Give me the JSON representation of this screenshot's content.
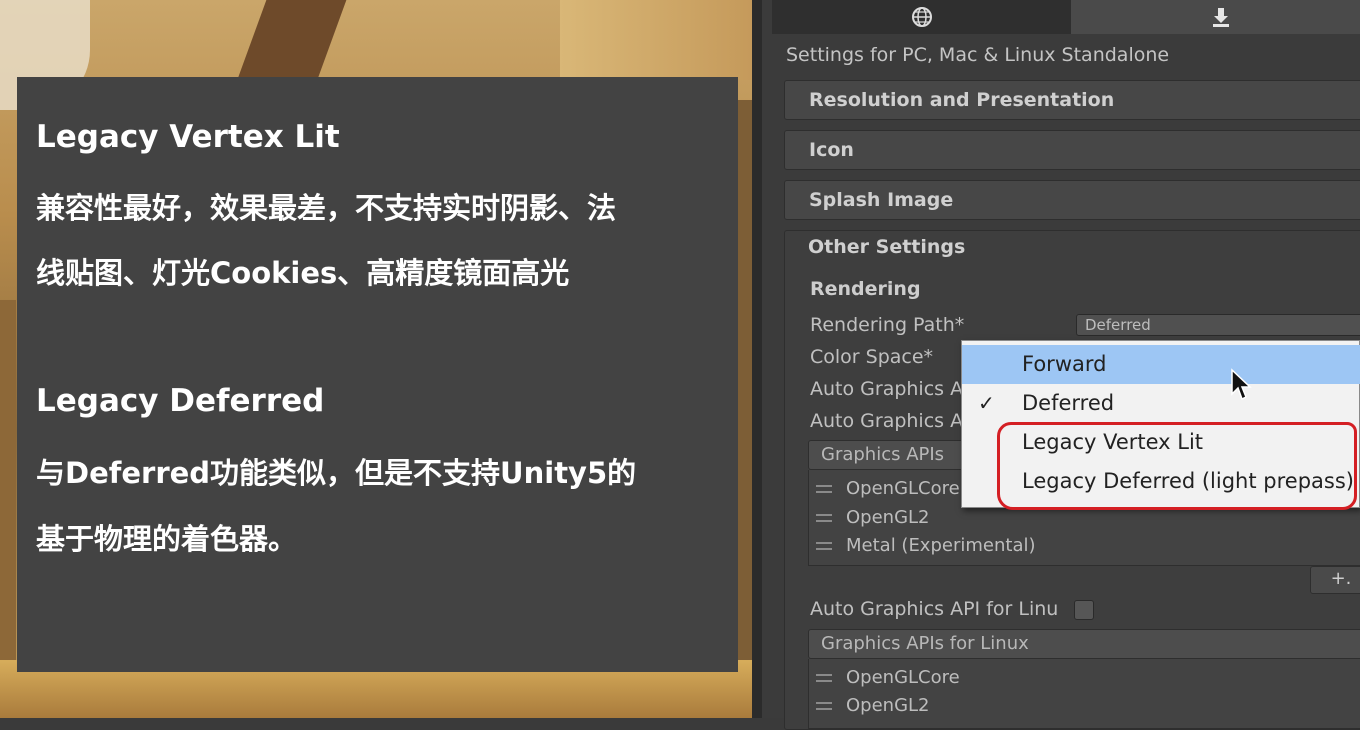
{
  "overlay": {
    "title1": "Legacy Vertex Lit",
    "body1_line1": "兼容性最好，效果最差，不支持实时阴影、法",
    "body1_line2": "线贴图、灯光Cookies、高精度镜面高光",
    "title2": "Legacy Deferred",
    "body2_line1": "与Deferred功能类似，但是不支持Unity5的",
    "body2_line2": "基于物理的着色器。"
  },
  "inspector": {
    "tabs": [
      {
        "icon": "globe-icon",
        "active": false
      },
      {
        "icon": "download-icon",
        "active": true
      }
    ],
    "settings_for": "Settings for PC, Mac & Linux Standalone",
    "sections": {
      "resolution": "Resolution and Presentation",
      "icon": "Icon",
      "splash": "Splash Image",
      "other": "Other Settings"
    },
    "rendering_header": "Rendering",
    "rows": {
      "rendering_path_label": "Rendering Path*",
      "rendering_path_value": "Deferred",
      "color_space_label": "Color Space*",
      "auto_api_1": "Auto Graphics A",
      "auto_api_2": "Auto Graphics A",
      "auto_api_linux": "Auto Graphics API for Linu"
    },
    "api_mac": {
      "header": "Graphics APIs",
      "items": [
        "OpenGLCore",
        "OpenGL2",
        "Metal (Experimental)"
      ]
    },
    "plus_label": "+.",
    "api_linux": {
      "header": "Graphics APIs for Linux",
      "items": [
        "OpenGLCore",
        "OpenGL2"
      ]
    }
  },
  "menu": {
    "items": [
      {
        "label": "Forward",
        "checked": false,
        "hover": true
      },
      {
        "label": "Deferred",
        "checked": true,
        "hover": false
      },
      {
        "label": "Legacy Vertex Lit",
        "checked": false,
        "hover": false
      },
      {
        "label": "Legacy Deferred (light prepass)",
        "checked": false,
        "hover": false
      }
    ],
    "check_glyph": "✓"
  },
  "colors": {
    "overlay_bg": "#434343",
    "menu_hover": "#9dc6f4",
    "annotation_red": "#d41f24"
  }
}
